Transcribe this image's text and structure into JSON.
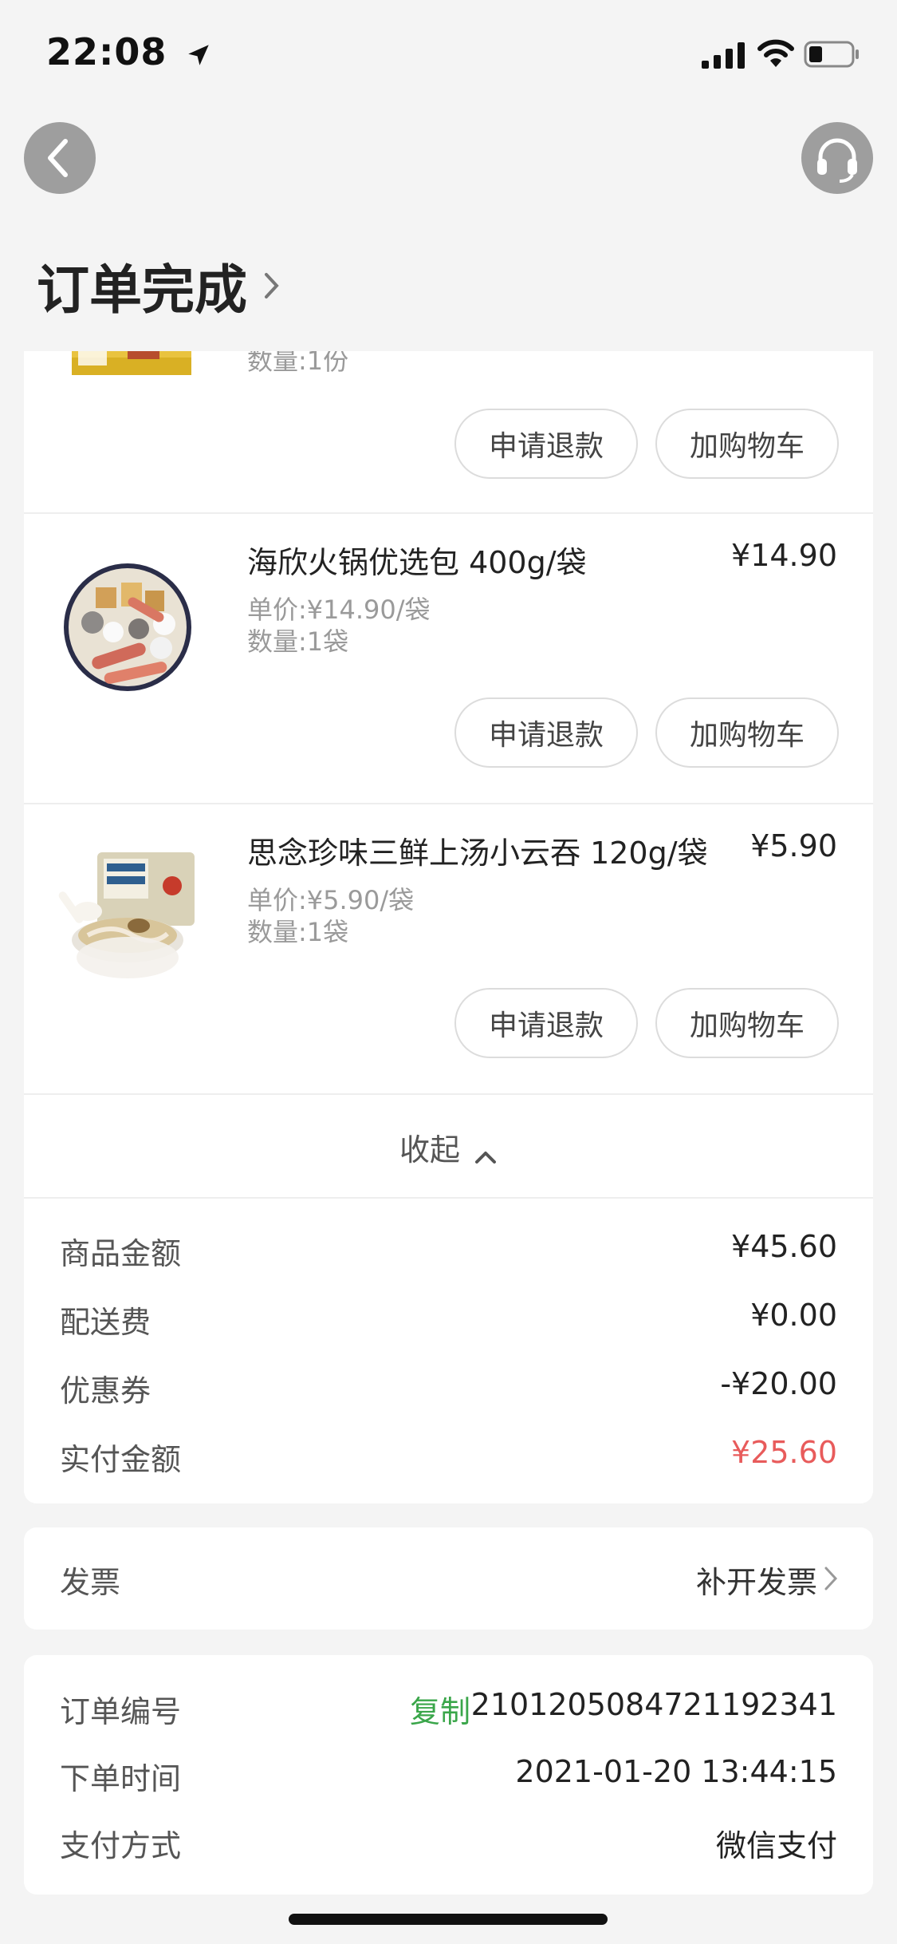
{
  "status_bar": {
    "time": "22:08"
  },
  "header": {
    "title": "订单完成"
  },
  "products": [
    {
      "name": "",
      "price": "",
      "unit_price": "",
      "quantity": "数量:1份",
      "refund_label": "申请退款",
      "cart_label": "加购物车"
    },
    {
      "name": "海欣火锅优选包 400g/袋",
      "price": "¥14.90",
      "unit_price": "单价:¥14.90/袋",
      "quantity": "数量:1袋",
      "refund_label": "申请退款",
      "cart_label": "加购物车"
    },
    {
      "name": "思念珍味三鲜上汤小云吞 120g/袋",
      "price": "¥5.90",
      "unit_price": "单价:¥5.90/袋",
      "quantity": "数量:1袋",
      "refund_label": "申请退款",
      "cart_label": "加购物车"
    }
  ],
  "collapse_label": "收起",
  "summary": {
    "goods_label": "商品金额",
    "goods_value": "¥45.60",
    "delivery_label": "配送费",
    "delivery_value": "¥0.00",
    "coupon_label": "优惠券",
    "coupon_value": "-¥20.00",
    "paid_label": "实付金额",
    "paid_value": "¥25.60"
  },
  "invoice": {
    "label": "发票",
    "action": "补开发票"
  },
  "order_info": {
    "number_label": "订单编号",
    "copy_label": "复制",
    "number_value": "2101205084721192341",
    "time_label": "下单时间",
    "time_value": "2021-01-20 13:44:15",
    "payment_label": "支付方式",
    "payment_value": "微信支付"
  },
  "colors": {
    "accent_red": "#e85b5b",
    "copy_green": "#3aa64a",
    "background": "#f4f4f4"
  }
}
